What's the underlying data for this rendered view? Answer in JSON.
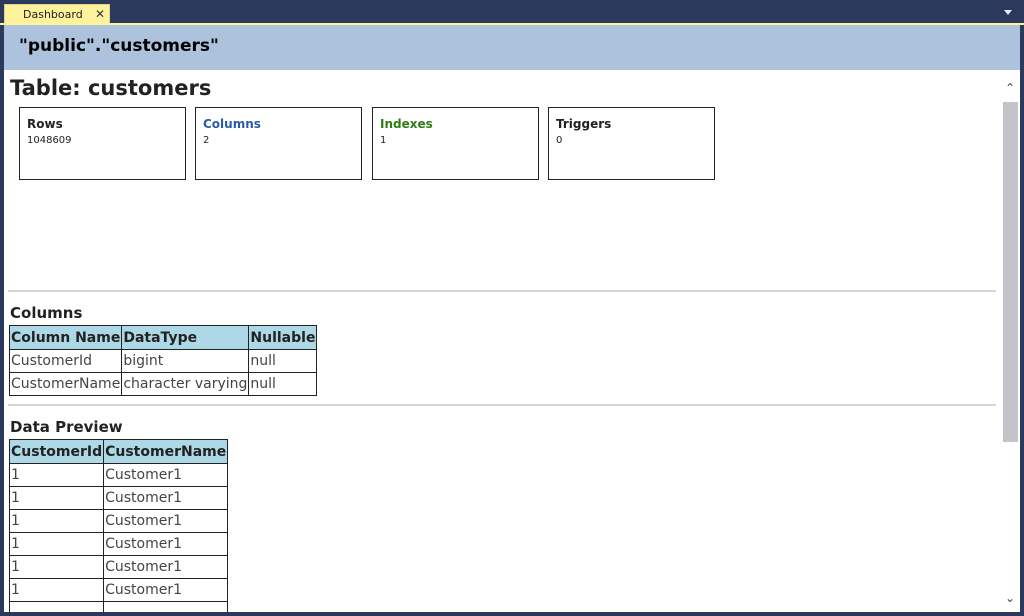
{
  "tab": {
    "label": "Dashboard",
    "close_glyph": "✕"
  },
  "header": {
    "title": "\"public\".\"customers\""
  },
  "page": {
    "title": "Table: customers"
  },
  "cards": [
    {
      "title": "Rows",
      "value": "1048609",
      "color": "#222222"
    },
    {
      "title": "Columns",
      "value": "2",
      "color": "#2a5aa8"
    },
    {
      "title": "Indexes",
      "value": "1",
      "color": "#2e7d16"
    },
    {
      "title": "Triggers",
      "value": "0",
      "color": "#222222"
    }
  ],
  "columns_section": {
    "title": "Columns",
    "headers": [
      "Column Name",
      "DataType",
      "Nullable"
    ],
    "rows": [
      [
        "CustomerId",
        "bigint",
        "null"
      ],
      [
        "CustomerName",
        "character varying",
        "null"
      ]
    ]
  },
  "preview_section": {
    "title": "Data Preview",
    "headers": [
      "CustomerId",
      "CustomerName"
    ],
    "rows": [
      [
        "1",
        "Customer1"
      ],
      [
        "1",
        "Customer1"
      ],
      [
        "1",
        "Customer1"
      ],
      [
        "1",
        "Customer1"
      ],
      [
        "1",
        "Customer1"
      ],
      [
        "1",
        "Customer1"
      ],
      [
        "",
        ""
      ]
    ]
  },
  "scrollbar": {
    "up_glyph": "⌃",
    "down_glyph": "⌄"
  },
  "colors": {
    "frame": "#2b3a5c",
    "tab": "#fff29d",
    "header": "#adc2dc",
    "table_header": "#add8e6"
  }
}
